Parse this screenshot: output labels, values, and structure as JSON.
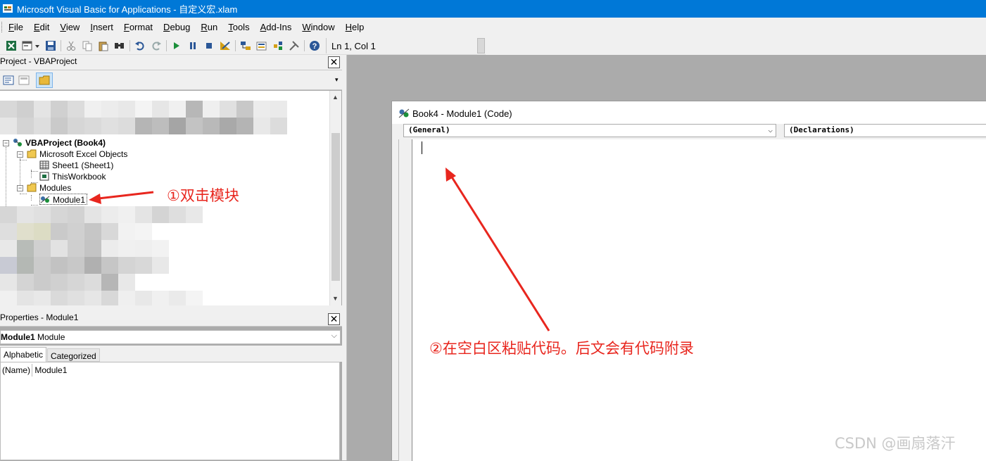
{
  "window": {
    "title": "Microsoft Visual Basic for Applications - 自定义宏.xlam"
  },
  "menu": [
    "File",
    "Edit",
    "View",
    "Insert",
    "Format",
    "Debug",
    "Run",
    "Tools",
    "Add-Ins",
    "Window",
    "Help"
  ],
  "toolbar": {
    "icons": [
      "excel-icon",
      "insert-userform-icon",
      "dropdown-icon",
      "save-icon",
      "cut-icon",
      "copy-icon",
      "paste-icon",
      "find-icon",
      "undo-icon",
      "redo-icon",
      "run-icon",
      "break-icon",
      "reset-icon",
      "design-mode-icon",
      "project-explorer-icon",
      "properties-icon",
      "object-browser-icon",
      "toolbox-icon",
      "help-icon"
    ],
    "cursor_position": "Ln 1, Col 1"
  },
  "project_explorer": {
    "title": "Project - VBAProject",
    "close_label": "✕",
    "tree": {
      "project": "VBAProject (Book4)",
      "excel_objects_folder": "Microsoft Excel Objects",
      "sheet1": "Sheet1 (Sheet1)",
      "this_workbook": "ThisWorkbook",
      "modules_folder": "Modules",
      "module1": "Module1"
    }
  },
  "properties": {
    "title": "Properties - Module1",
    "close_label": "✕",
    "object_name": "Module1",
    "object_type": "Module",
    "tabs": [
      "Alphabetic",
      "Categorized"
    ],
    "rows": [
      {
        "key": "(Name)",
        "value": "Module1"
      }
    ]
  },
  "code_window": {
    "title": "Book4 - Module1 (Code)",
    "object_combo": "(General)",
    "procedure_combo": "(Declarations)"
  },
  "annotations": {
    "step1": "①双击模块",
    "step2": "②在空白区粘贴代码。后文会有代码附录"
  },
  "watermark": "CSDN @画扇落汗",
  "colors": {
    "titlebar": "#0078d7",
    "annotation": "#e8261e"
  }
}
